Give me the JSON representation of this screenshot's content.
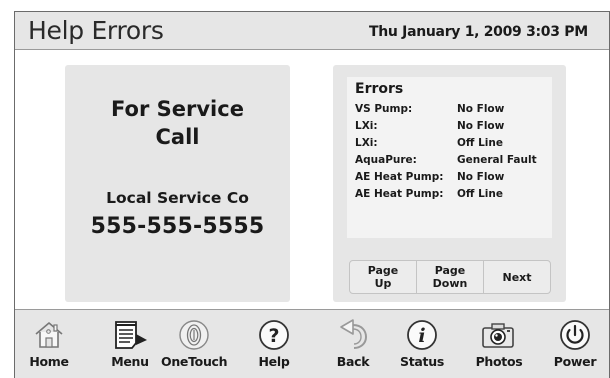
{
  "header": {
    "title": "Help Errors",
    "datetime": "Thu January 1, 2009  3:03 PM"
  },
  "service": {
    "heading_line1": "For Service",
    "heading_line2": "Call",
    "company": "Local Service Co",
    "phone": "555-555-5555"
  },
  "errors": {
    "title": "Errors",
    "rows": [
      {
        "device": "VS Pump:",
        "status": "No Flow"
      },
      {
        "device": "LXi:",
        "status": "No Flow"
      },
      {
        "device": "LXi:",
        "status": "Off Line"
      },
      {
        "device": "AquaPure:",
        "status": "General Fault"
      },
      {
        "device": "AE Heat Pump:",
        "status": "No Flow"
      },
      {
        "device": "AE Heat Pump:",
        "status": "Off Line"
      }
    ]
  },
  "pager": {
    "page_up_line1": "Page",
    "page_up_line2": "Up",
    "page_down_line1": "Page",
    "page_down_line2": "Down",
    "next": "Next"
  },
  "nav": {
    "home": {
      "label": "Home",
      "icon": "house-icon"
    },
    "menu": {
      "label": "Menu",
      "icon": "notepad-icon"
    },
    "onetouch": {
      "label": "OneTouch",
      "icon": "fingerprint-icon"
    },
    "help": {
      "label": "Help",
      "icon": "question-circle-icon"
    },
    "back": {
      "label": "Back",
      "icon": "back-arrow-icon"
    },
    "status": {
      "label": "Status",
      "icon": "info-circle-icon"
    },
    "photos": {
      "label": "Photos",
      "icon": "camera-icon"
    },
    "power": {
      "label": "Power",
      "icon": "power-icon"
    }
  }
}
